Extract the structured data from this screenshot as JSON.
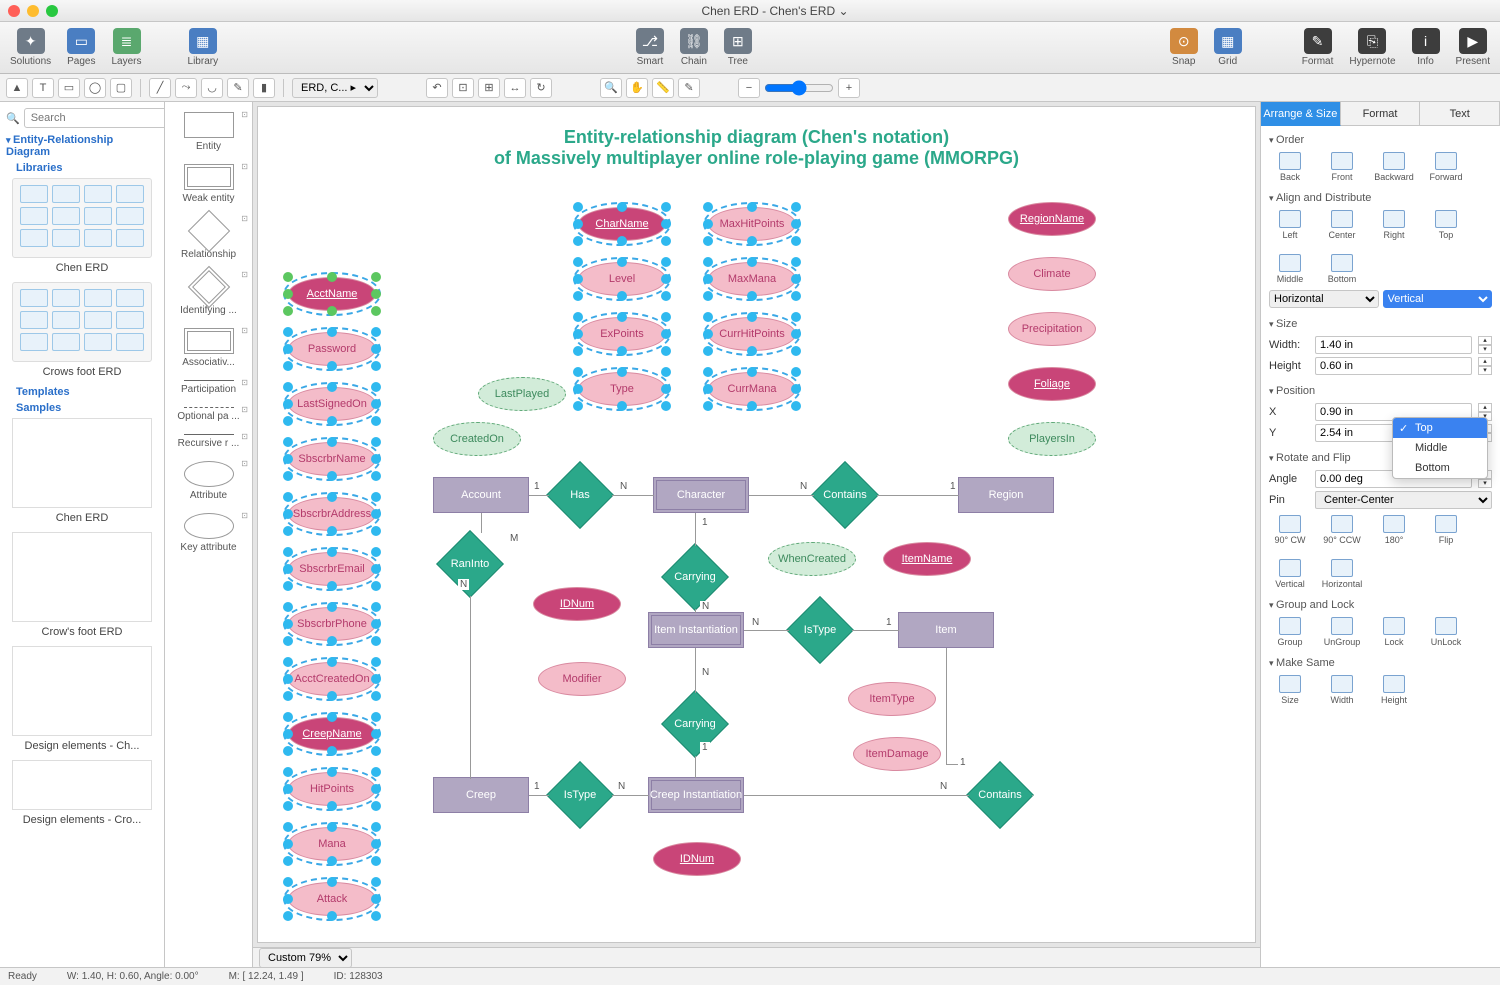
{
  "window": {
    "title": "Chen ERD - Chen's ERD ⌄"
  },
  "toolbar": {
    "left": [
      {
        "label": "Solutions"
      },
      {
        "label": "Pages"
      },
      {
        "label": "Layers"
      },
      {
        "label": "Library"
      }
    ],
    "center": [
      {
        "label": "Smart"
      },
      {
        "label": "Chain"
      },
      {
        "label": "Tree"
      }
    ],
    "right1": [
      {
        "label": "Snap"
      },
      {
        "label": "Grid"
      }
    ],
    "right2": [
      {
        "label": "Format"
      },
      {
        "label": "Hypernote"
      },
      {
        "label": "Info"
      },
      {
        "label": "Present"
      }
    ]
  },
  "leftnav": {
    "search_placeholder": "Search",
    "root": "Entity-Relationship Diagram",
    "sections": {
      "libraries": "Libraries",
      "templates": "Templates",
      "samples": "Samples"
    },
    "lib_items": [
      "Chen ERD",
      "Crows foot ERD"
    ],
    "sample_items": [
      "Chen ERD",
      "Crow's foot ERD",
      "Design elements - Ch...",
      "Design elements - Cro..."
    ]
  },
  "breadcrumb": "ERD, C... ▸",
  "shapes": [
    {
      "label": "Entity",
      "variant": "rect"
    },
    {
      "label": "Weak entity",
      "variant": "rect dbl"
    },
    {
      "label": "Relationship",
      "variant": "diamond"
    },
    {
      "label": "Identifying ...",
      "variant": "diamond dbl"
    },
    {
      "label": "Associativ...",
      "variant": "rect dbl"
    },
    {
      "label": "Participation",
      "variant": "line"
    },
    {
      "label": "Optional pa ...",
      "variant": "line dashed"
    },
    {
      "label": "Recursive r ...",
      "variant": "line"
    },
    {
      "label": "Attribute",
      "variant": "oval"
    },
    {
      "label": "Key attribute",
      "variant": "oval"
    }
  ],
  "diagram": {
    "title_line1": "Entity-relationship diagram (Chen's notation)",
    "title_line2": "of Massively multiplayer online role-playing game (MMORPG)",
    "left_col": [
      "AcctName",
      "Password",
      "LastSignedOn",
      "SbscrbrName",
      "SbscrbrAddress",
      "SbscrbrEmail",
      "SbscrbrPhone",
      "AcctCreatedOn",
      "CreepName",
      "HitPoints",
      "Mana",
      "Attack"
    ],
    "col2": [
      "CharName",
      "Level",
      "ExPoints",
      "Type"
    ],
    "col3": [
      "MaxHitPoints",
      "MaxMana",
      "CurrHitPoints",
      "CurrMana"
    ],
    "region_col": [
      "RegionName",
      "Climate",
      "Precipitation",
      "Foliage",
      "PlayersIn"
    ],
    "float_attrs": {
      "CreatedOn": "CreatedOn",
      "LastPlayed": "LastPlayed",
      "WhenCreated": "WhenCreated",
      "IDNum1": "IDNum",
      "Modifier": "Modifier",
      "IDNum2": "IDNum",
      "ItemName": "ItemName",
      "ItemType": "ItemType",
      "ItemDamage": "ItemDamage"
    },
    "entities": {
      "Account": "Account",
      "Character": "Character",
      "Region": "Region",
      "ItemInst": "Item Instantiation",
      "Item": "Item",
      "Creep": "Creep",
      "CreepInst": "Creep Instantiation"
    },
    "rels": {
      "Has": "Has",
      "Contains1": "Contains",
      "RanInto": "RanInto",
      "Carrying1": "Carrying",
      "IsType1": "IsType",
      "Carrying2": "Carrying",
      "IsType2": "IsType",
      "Contains2": "Contains"
    },
    "cards": {
      "one": "1",
      "many": "N",
      "m": "M"
    }
  },
  "zoom": {
    "label": "Custom 79%"
  },
  "right": {
    "tabs": [
      "Arrange & Size",
      "Format",
      "Text"
    ],
    "order": {
      "hdr": "Order",
      "items": [
        "Back",
        "Front",
        "Backward",
        "Forward"
      ]
    },
    "align": {
      "hdr": "Align and Distribute",
      "items": [
        "Left",
        "Center",
        "Right",
        "Top",
        "Middle",
        "Bottom"
      ],
      "h": "Horizontal",
      "v": "Vertical",
      "dd": [
        "Top",
        "Middle",
        "Bottom"
      ]
    },
    "size": {
      "hdr": "Size",
      "w_label": "Width:",
      "h_label": "Height",
      "w": "1.40 in",
      "h": "0.60 in"
    },
    "pos": {
      "hdr": "Position",
      "x_label": "X",
      "y_label": "Y",
      "x": "0.90 in",
      "y": "2.54 in"
    },
    "rotate": {
      "hdr": "Rotate and Flip",
      "angle_label": "Angle",
      "angle": "0.00 deg",
      "pin_label": "Pin",
      "pin": "Center-Center",
      "items": [
        "90° CW",
        "90° CCW",
        "180°",
        "Flip",
        "Vertical",
        "Horizontal"
      ]
    },
    "group": {
      "hdr": "Group and Lock",
      "items": [
        "Group",
        "UnGroup",
        "Lock",
        "UnLock"
      ]
    },
    "same": {
      "hdr": "Make Same",
      "items": [
        "Size",
        "Width",
        "Height"
      ]
    }
  },
  "status": {
    "ready": "Ready",
    "wh": "W: 1.40,  H: 0.60,  Angle: 0.00°",
    "m": "M: [ 12.24, 1.49 ]",
    "id": "ID: 128303"
  }
}
